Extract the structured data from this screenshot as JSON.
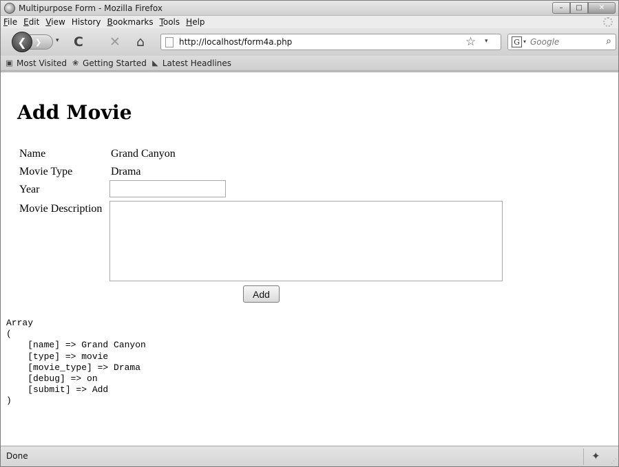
{
  "window": {
    "title": "Multipurpose Form - Mozilla Firefox",
    "controls": {
      "minimize": "–",
      "maximize": "□",
      "close": "✕"
    }
  },
  "menu": {
    "items": [
      {
        "label": "File",
        "key": "F",
        "rest": "ile"
      },
      {
        "label": "Edit",
        "key": "E",
        "rest": "dit"
      },
      {
        "label": "View",
        "key": "V",
        "rest": "iew"
      },
      {
        "label": "History",
        "key": "",
        "rest": "History"
      },
      {
        "label": "Bookmarks",
        "key": "B",
        "rest": "ookmarks"
      },
      {
        "label": "Tools",
        "key": "T",
        "rest": "ools"
      },
      {
        "label": "Help",
        "key": "H",
        "rest": "elp"
      }
    ]
  },
  "toolbar": {
    "back_glyph": "❮",
    "forward_glyph": "❯",
    "dropdown_glyph": "▾",
    "reload_glyph": "C",
    "stop_glyph": "✕",
    "home_glyph": "⌂",
    "url": "http://localhost/form4a.php",
    "star_glyph": "☆",
    "search_engine_glyph": "G",
    "search_placeholder": "Google",
    "search_glyph": "⌕"
  },
  "bookmarks": {
    "items": [
      {
        "label": "Most Visited",
        "icon": "most-visited-icon",
        "glyph": "▣"
      },
      {
        "label": "Getting Started",
        "icon": "firefox-icon",
        "glyph": "❀"
      },
      {
        "label": "Latest Headlines",
        "icon": "rss-icon",
        "glyph": "◣"
      }
    ]
  },
  "page": {
    "title": "Add Movie",
    "fields": {
      "name_label": "Name",
      "name_value": "Grand Canyon",
      "type_label": "Movie Type",
      "type_value": "Drama",
      "year_label": "Year",
      "year_value": "",
      "desc_label": "Movie Description",
      "desc_value": ""
    },
    "submit_label": "Add",
    "debug_output": "Array\n(\n    [name] => Grand Canyon\n    [type] => movie\n    [movie_type] => Drama\n    [debug] => on\n    [submit] => Add\n)"
  },
  "status": {
    "text": "Done",
    "addon_glyph": "✦",
    "grip_glyph": "⋰"
  }
}
